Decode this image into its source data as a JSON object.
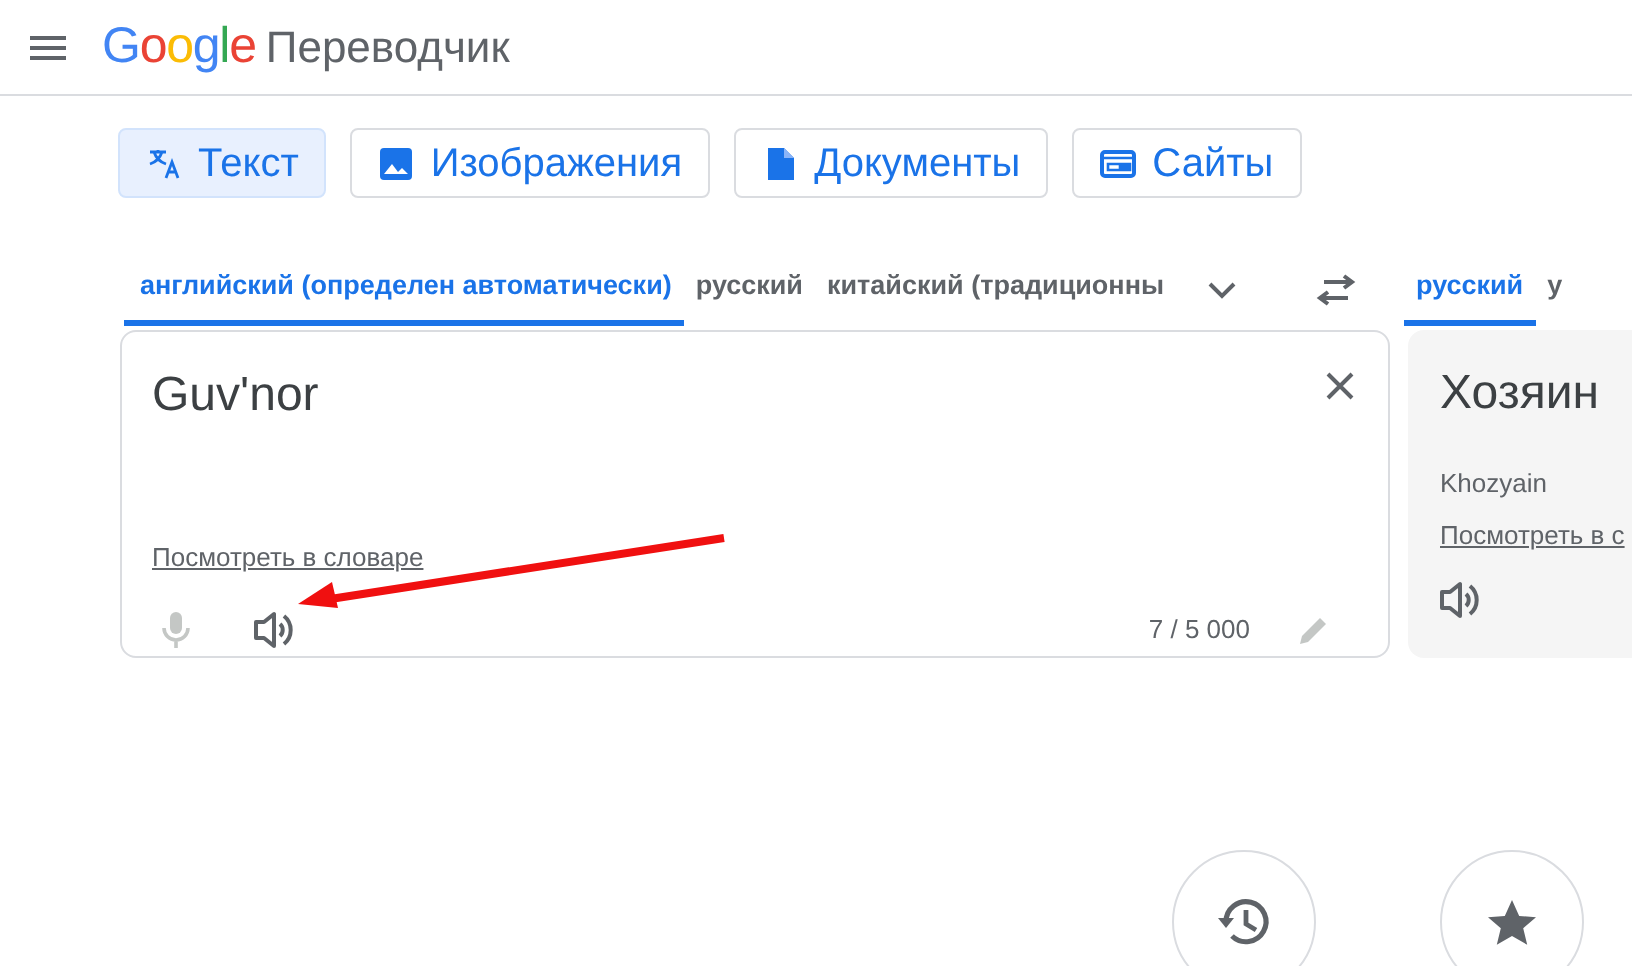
{
  "header": {
    "logo": "Google",
    "product": "Переводчик"
  },
  "modes": [
    {
      "label": "Текст",
      "kind": "text",
      "selected": true
    },
    {
      "label": "Изображения",
      "kind": "image",
      "selected": false
    },
    {
      "label": "Документы",
      "kind": "document",
      "selected": false
    },
    {
      "label": "Сайты",
      "kind": "site",
      "selected": false
    }
  ],
  "source_languages": [
    {
      "label": "английский (определен автоматически)",
      "selected": true
    },
    {
      "label": "русский",
      "selected": false
    },
    {
      "label": "китайский (традиционны",
      "selected": false
    }
  ],
  "target_languages": [
    {
      "label": "русский",
      "selected": true
    },
    {
      "label": "у",
      "selected": false
    }
  ],
  "source": {
    "text": "Guv'nor",
    "dictionary_link": "Посмотреть в словаре",
    "counter": "7 / 5 000"
  },
  "target": {
    "text": "Хозяин",
    "transliteration": "Khozyain",
    "dictionary_link": "Посмотреть в с"
  }
}
